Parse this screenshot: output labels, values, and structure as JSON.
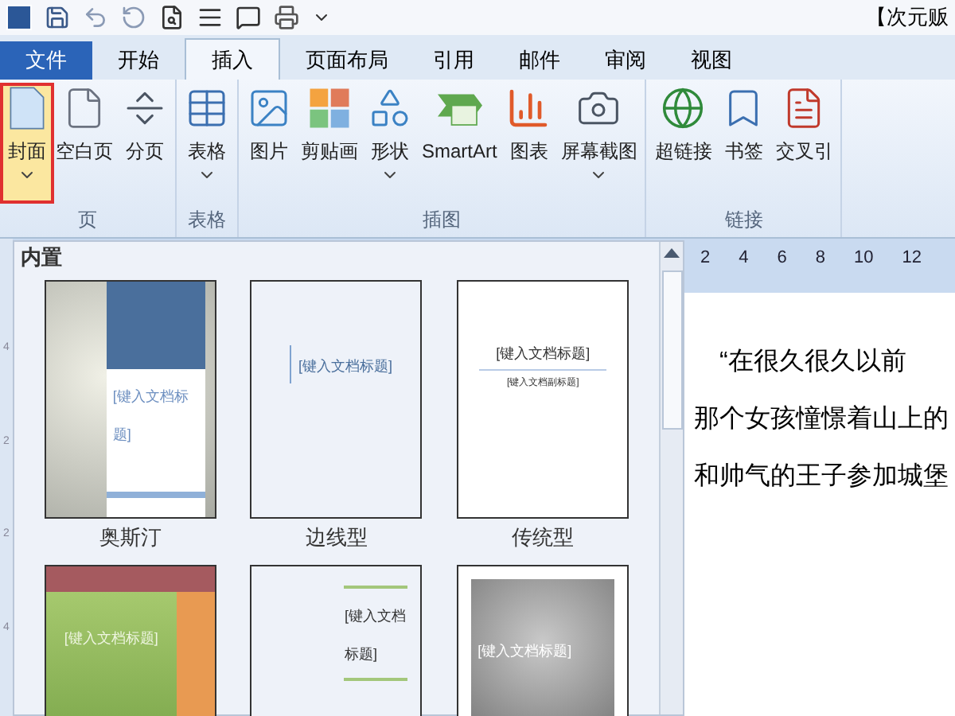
{
  "window": {
    "title": "【次元贩"
  },
  "tabs": [
    {
      "label": "文件",
      "kind": "file",
      "selected": false
    },
    {
      "label": "开始",
      "kind": "tab",
      "selected": false
    },
    {
      "label": "插入",
      "kind": "tab",
      "selected": true
    },
    {
      "label": "页面布局",
      "kind": "tab",
      "selected": false
    },
    {
      "label": "引用",
      "kind": "tab",
      "selected": false
    },
    {
      "label": "邮件",
      "kind": "tab",
      "selected": false
    },
    {
      "label": "审阅",
      "kind": "tab",
      "selected": false
    },
    {
      "label": "视图",
      "kind": "tab",
      "selected": false
    }
  ],
  "ribbon_groups": [
    {
      "label": "页",
      "buttons": [
        {
          "label": "封面",
          "dropdown": true,
          "selected": true
        },
        {
          "label": "空白页",
          "dropdown": false,
          "selected": false
        },
        {
          "label": "分页",
          "dropdown": false,
          "selected": false
        }
      ]
    },
    {
      "label": "表格",
      "buttons": [
        {
          "label": "表格",
          "dropdown": true,
          "selected": false
        }
      ]
    },
    {
      "label": "插图",
      "buttons": [
        {
          "label": "图片",
          "dropdown": false,
          "selected": false
        },
        {
          "label": "剪贴画",
          "dropdown": false,
          "selected": false
        },
        {
          "label": "形状",
          "dropdown": true,
          "selected": false
        },
        {
          "label": "SmartArt",
          "dropdown": false,
          "selected": false
        },
        {
          "label": "图表",
          "dropdown": false,
          "selected": false
        },
        {
          "label": "屏幕截图",
          "dropdown": true,
          "selected": false
        }
      ]
    },
    {
      "label": "链接",
      "buttons": [
        {
          "label": "超链接",
          "dropdown": false,
          "selected": false
        },
        {
          "label": "书签",
          "dropdown": false,
          "selected": false
        },
        {
          "label": "交叉引",
          "dropdown": false,
          "selected": false
        }
      ]
    }
  ],
  "gallery": {
    "heading": "内置",
    "items": [
      {
        "label": "奥斯汀",
        "kind": "austin",
        "title": "[键入文档标题]"
      },
      {
        "label": "边线型",
        "kind": "sideline",
        "title": "[键入文档标题]"
      },
      {
        "label": "传统型",
        "kind": "traditional",
        "title": "[键入文档标题]",
        "subtitle": "[键入文档副标题]"
      },
      {
        "kind": "mosaic",
        "title": "[键入文档标题]"
      },
      {
        "kind": "stacks",
        "title": "[键入文档标题]"
      },
      {
        "kind": "grey",
        "title": "[键入文档标题]"
      }
    ]
  },
  "ruler": {
    "ticks": [
      "2",
      "4",
      "6",
      "8",
      "10",
      "12"
    ]
  },
  "vertical_ruler": {
    "ticks": [
      "4",
      "2",
      "2",
      "4"
    ]
  },
  "document": {
    "paragraphs": [
      "“在很久很久以前",
      "那个女孩憧憬着山上的",
      "和帅气的王子参加城堡"
    ]
  }
}
